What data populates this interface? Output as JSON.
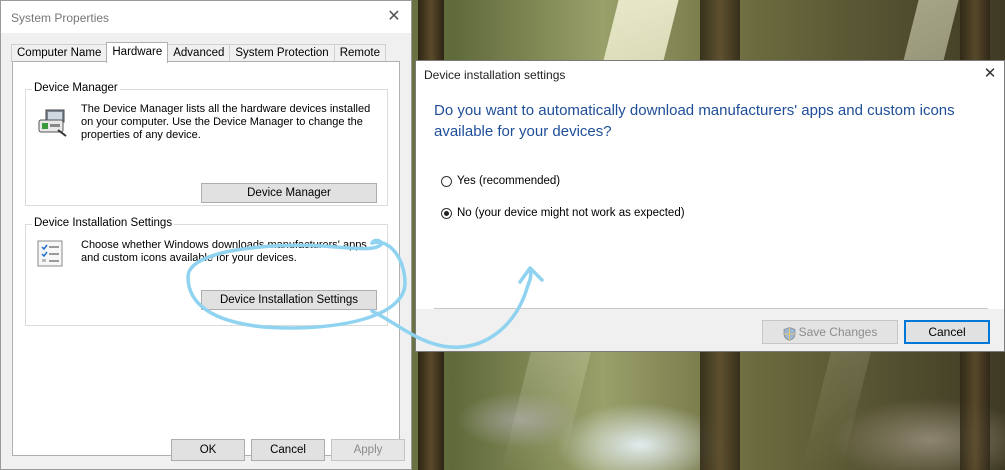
{
  "system_properties": {
    "title": "System Properties",
    "tabs": [
      {
        "label": "Computer Name",
        "active": false
      },
      {
        "label": "Hardware",
        "active": true
      },
      {
        "label": "Advanced",
        "active": false
      },
      {
        "label": "System Protection",
        "active": false
      },
      {
        "label": "Remote",
        "active": false
      }
    ],
    "device_manager": {
      "group_label": "Device Manager",
      "description": "The Device Manager lists all the hardware devices installed on your computer. Use the Device Manager to change the properties of any device.",
      "button_label": "Device Manager"
    },
    "device_installation": {
      "group_label": "Device Installation Settings",
      "description": "Choose whether Windows downloads manufacturers' apps and custom icons available for your devices.",
      "button_label": "Device Installation Settings"
    },
    "footer": {
      "ok_label": "OK",
      "cancel_label": "Cancel",
      "apply_label": "Apply"
    }
  },
  "device_installation_dialog": {
    "title": "Device installation settings",
    "question": "Do you want to automatically download manufacturers' apps and custom icons available for your devices?",
    "options": [
      {
        "label": "Yes (recommended)",
        "checked": false
      },
      {
        "label": "No (your device might not work as expected)",
        "checked": true
      }
    ],
    "save_label": "Save Changes",
    "cancel_label": "Cancel"
  },
  "colors": {
    "question_text": "#1f4e99",
    "annotation_stroke": "#8fd3f0",
    "focus_border": "#0078d7"
  }
}
